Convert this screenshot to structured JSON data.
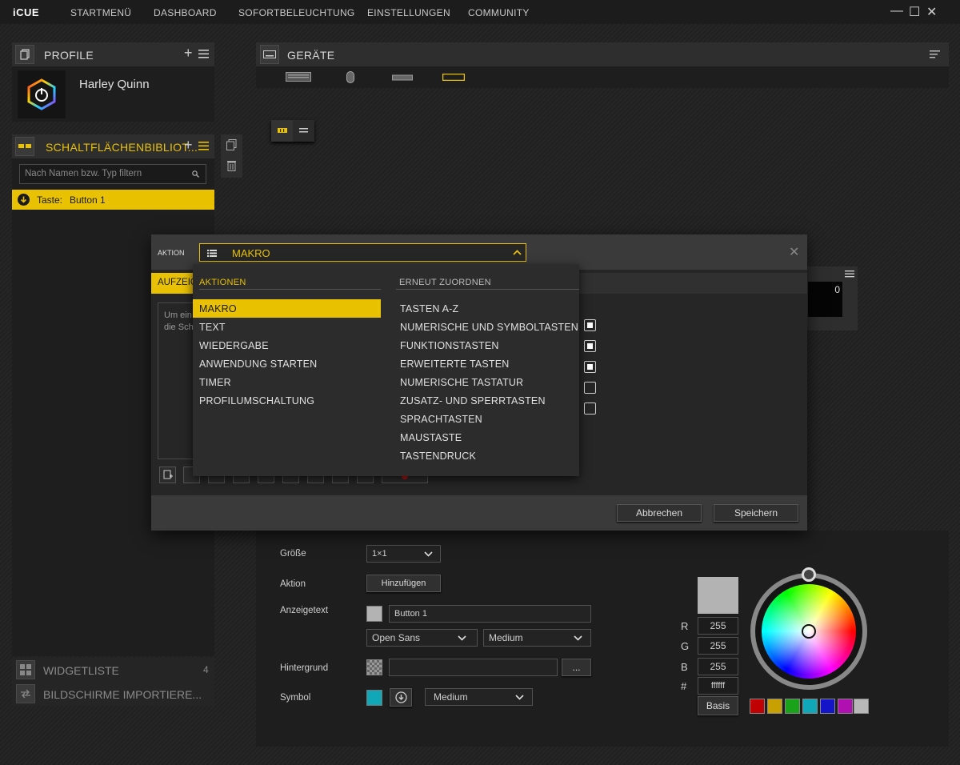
{
  "app": {
    "logo": "iCUE"
  },
  "nav": [
    "STARTMENÜ",
    "DASHBOARD",
    "SOFORTBELEUCHTUNG",
    "EINSTELLUNGEN",
    "COMMUNITY"
  ],
  "window": {
    "minimize": "—",
    "maximize": "☐",
    "close": "✕"
  },
  "profile": {
    "title": "PROFILE",
    "name": "Harley Quinn"
  },
  "library": {
    "title": "SCHALTFLÄCHENBIBLIOT...",
    "search_placeholder": "Nach Namen bzw. Typ filtern",
    "item_type": "Taste:",
    "item_name": "Button 1"
  },
  "bottom_left": {
    "widgets": "WIDGETLISTE",
    "widgets_count": "4",
    "import": "BILDSCHIRME IMPORTIERE..."
  },
  "devices": {
    "title": "GERÄTE"
  },
  "preview": {
    "value": "0"
  },
  "dialog": {
    "action_label": "AKTION",
    "selected_action": "MAKRO",
    "tab_partial": "AUFZEICH",
    "text_partial_1": "Um ein",
    "text_partial_2": "die Sch",
    "cancel": "Abbrechen",
    "save": "Speichern",
    "checkboxes": [
      true,
      true,
      true,
      false,
      false
    ]
  },
  "dropdown": {
    "actions_header": "AKTIONEN",
    "remap_header": "ERNEUT ZUORDNEN",
    "actions": [
      "MAKRO",
      "TEXT",
      "WIEDERGABE",
      "ANWENDUNG STARTEN",
      "TIMER",
      "PROFILUMSCHALTUNG"
    ],
    "remap": [
      "TASTEN A-Z",
      "NUMERISCHE UND SYMBOLTASTEN",
      "FUNKTIONSTASTEN",
      "ERWEITERTE TASTEN",
      "NUMERISCHE TASTATUR",
      "ZUSATZ- UND SPERRTASTEN",
      "SPRACHTASTEN",
      "MAUSTASTE",
      "TASTENDRUCK"
    ]
  },
  "props": {
    "size_label": "Größe",
    "size_value": "1×1",
    "action_label": "Aktion",
    "add_button": "Hinzufügen",
    "display_text_label": "Anzeigetext",
    "display_text_value": "Button 1",
    "font": "Open Sans",
    "weight": "Medium",
    "background_label": "Hintergrund",
    "background_value": "",
    "browse": "...",
    "symbol_label": "Symbol",
    "symbol_weight": "Medium"
  },
  "color": {
    "r_label": "R",
    "g_label": "G",
    "b_label": "B",
    "hex_label": "#",
    "r": "255",
    "g": "255",
    "b": "255",
    "hex": "ffffff",
    "basis": "Basis",
    "preview": "#b3b3b3",
    "presets": [
      "#c00000",
      "#c8a000",
      "#1aa21a",
      "#10a8b8",
      "#1414c8",
      "#b010b0",
      "#b8b8b8"
    ]
  },
  "colors": {
    "accent": "#e8c100"
  }
}
